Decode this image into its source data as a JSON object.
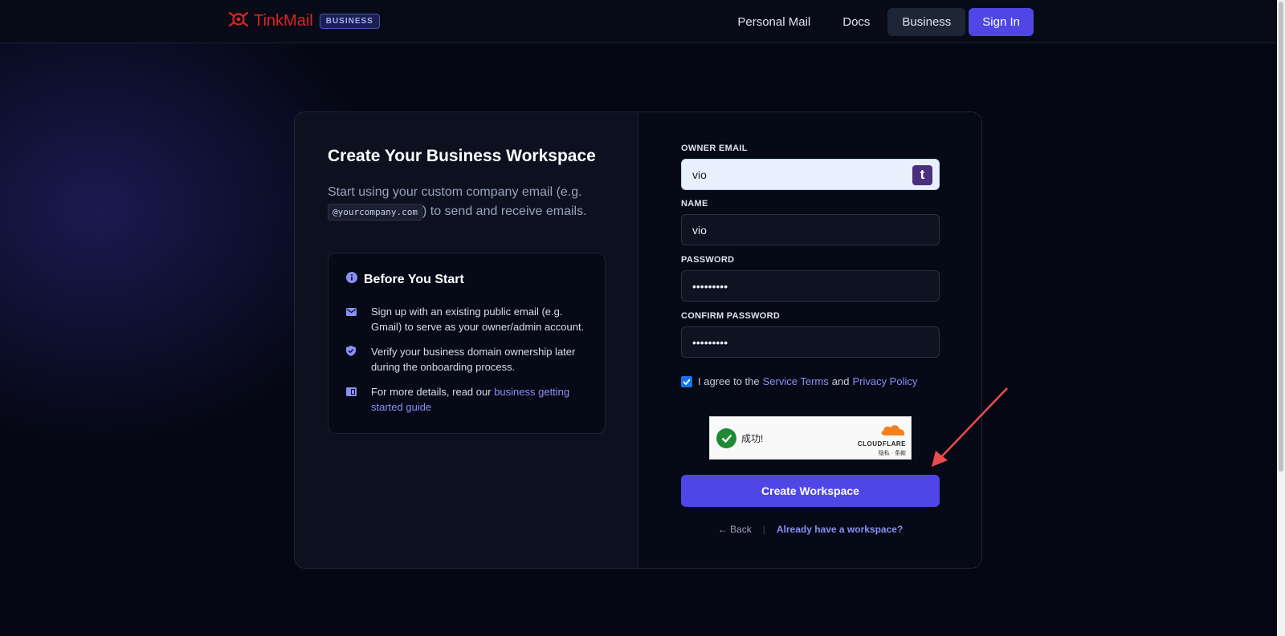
{
  "brand": {
    "name": "TinkMail",
    "badge": "BUSINESS"
  },
  "nav": {
    "personal": "Personal Mail",
    "docs": "Docs",
    "business": "Business",
    "signin": "Sign In"
  },
  "intro": {
    "title": "Create Your Business Workspace",
    "text_before": "Start using your custom company email (e.g. ",
    "code": "@yourcompany.com",
    "text_after": ") to send and receive emails."
  },
  "before": {
    "title": "Before You Start",
    "tip1": "Sign up with an existing public email (e.g. Gmail) to serve as your owner/admin account.",
    "tip2": "Verify your business domain ownership later during the onboarding process.",
    "tip3_prefix": "For more details, read our ",
    "tip3_link": "business getting started guide"
  },
  "form": {
    "owner_label": "OWNER EMAIL",
    "owner_value": "vio",
    "owner_button": "t",
    "name_label": "NAME",
    "name_value": "vio",
    "password_label": "PASSWORD",
    "password_value": "•••••••••",
    "confirm_label": "CONFIRM PASSWORD",
    "confirm_value": "•••••••••",
    "agree_prefix": "I agree to the",
    "terms": "Service Terms",
    "and": "and",
    "privacy": "Privacy Policy",
    "submit": "Create Workspace",
    "back": "← Back",
    "sep": "|",
    "already": "Already have a workspace?"
  },
  "captcha": {
    "status": "成功!",
    "brand": "CLOUDFLARE",
    "links": "隐私 · 条款"
  }
}
